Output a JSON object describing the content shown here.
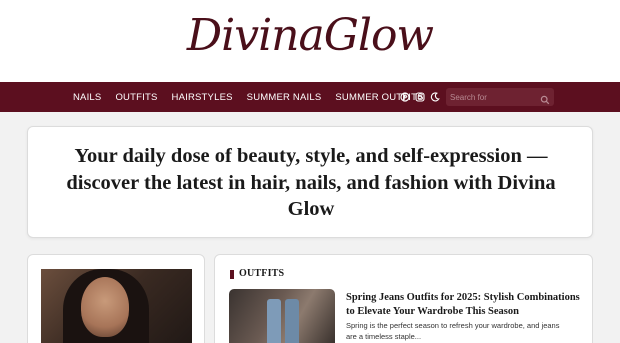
{
  "header": {
    "logo": "DivinaGlow"
  },
  "nav": {
    "items": [
      {
        "label": "NAILS"
      },
      {
        "label": "OUTFITS"
      },
      {
        "label": "HAIRSTYLES"
      },
      {
        "label": "SUMMER NAILS"
      },
      {
        "label": "SUMMER OUTFITS"
      }
    ],
    "icons": [
      "pinterest-icon",
      "instagram-icon",
      "moon-icon"
    ],
    "search": {
      "placeholder": "Search for",
      "icon": "search-icon"
    }
  },
  "hero": {
    "text": "Your daily dose of beauty, style, and self-expression — discover the latest in hair, nails, and fashion with Divina Glow"
  },
  "section": {
    "title": "OUTFITS",
    "article": {
      "title": "Spring Jeans Outfits for 2025: Stylish Combinations to Elevate Your Wardrobe This Season",
      "excerpt": "Spring is the perfect season to refresh your wardrobe, and jeans are a timeless staple..."
    }
  },
  "colors": {
    "brand": "#5c0f1f",
    "logo": "#4a0f1a",
    "background": "#f2f2f2"
  }
}
